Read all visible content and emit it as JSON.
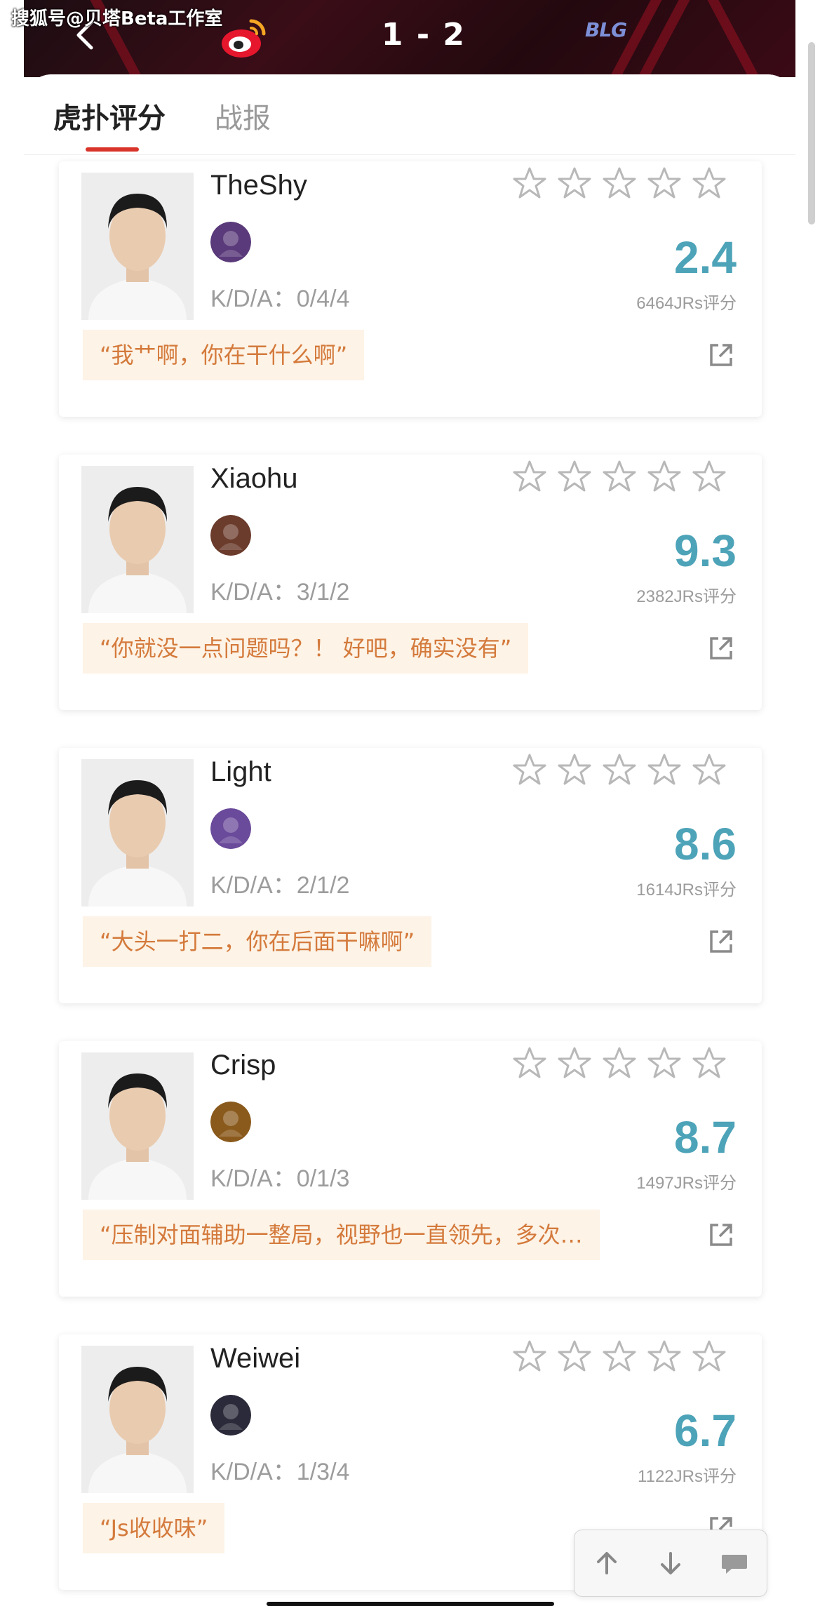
{
  "watermark": "搜狐号@贝塔Beta工作室",
  "header": {
    "score": "1 - 2",
    "right_team_logo_text": "BLG",
    "back_icon": "chevron-left-icon",
    "left_team_logo": "weibo-gaming-logo",
    "right_team_logo": "blg-logo"
  },
  "tabs": [
    {
      "label": "虎扑评分",
      "active": true
    },
    {
      "label": "战报",
      "active": false
    }
  ],
  "colors": {
    "accent": "#d9342a",
    "score": "#4da3b8",
    "quote_text": "#d47a3c",
    "quote_bg": "#fdf3e6",
    "header_bg": "#2a0b12"
  },
  "players": [
    {
      "name": "TheShy",
      "kda": "K/D/A：0/4/4",
      "rating": "2.4",
      "votes": "6464JRs评分",
      "quote": "“我艹啊，你在干什么啊”",
      "stars_filled": 0,
      "champion_icon": "champion-avatar-icon",
      "champ_color": "#5a3a7a"
    },
    {
      "name": "Xiaohu",
      "kda": "K/D/A：3/1/2",
      "rating": "9.3",
      "votes": "2382JRs评分",
      "quote": "“你就没一点问题吗？！ 好吧，确实没有”",
      "stars_filled": 0,
      "champion_icon": "champion-avatar-icon",
      "champ_color": "#6b3b2c"
    },
    {
      "name": "Light",
      "kda": "K/D/A：2/1/2",
      "rating": "8.6",
      "votes": "1614JRs评分",
      "quote": "“大头一打二，你在后面干嘛啊”",
      "stars_filled": 0,
      "champion_icon": "champion-avatar-icon",
      "champ_color": "#6a4a9a"
    },
    {
      "name": "Crisp",
      "kda": "K/D/A：0/1/3",
      "rating": "8.7",
      "votes": "1497JRs评分",
      "quote": "“压制对面辅助一整局，视野也一直领先，多次…",
      "stars_filled": 0,
      "champion_icon": "champion-avatar-icon",
      "champ_color": "#8a5a1c"
    },
    {
      "name": "Weiwei",
      "kda": "K/D/A：1/3/4",
      "rating": "6.7",
      "votes": "1122JRs评分",
      "quote": "“Js收收味”",
      "stars_filled": 0,
      "champion_icon": "champion-avatar-icon",
      "champ_color": "#2a2a3a"
    }
  ],
  "float_bar": {
    "up_icon": "arrow-up-icon",
    "down_icon": "arrow-down-icon",
    "comment_icon": "comment-icon"
  }
}
